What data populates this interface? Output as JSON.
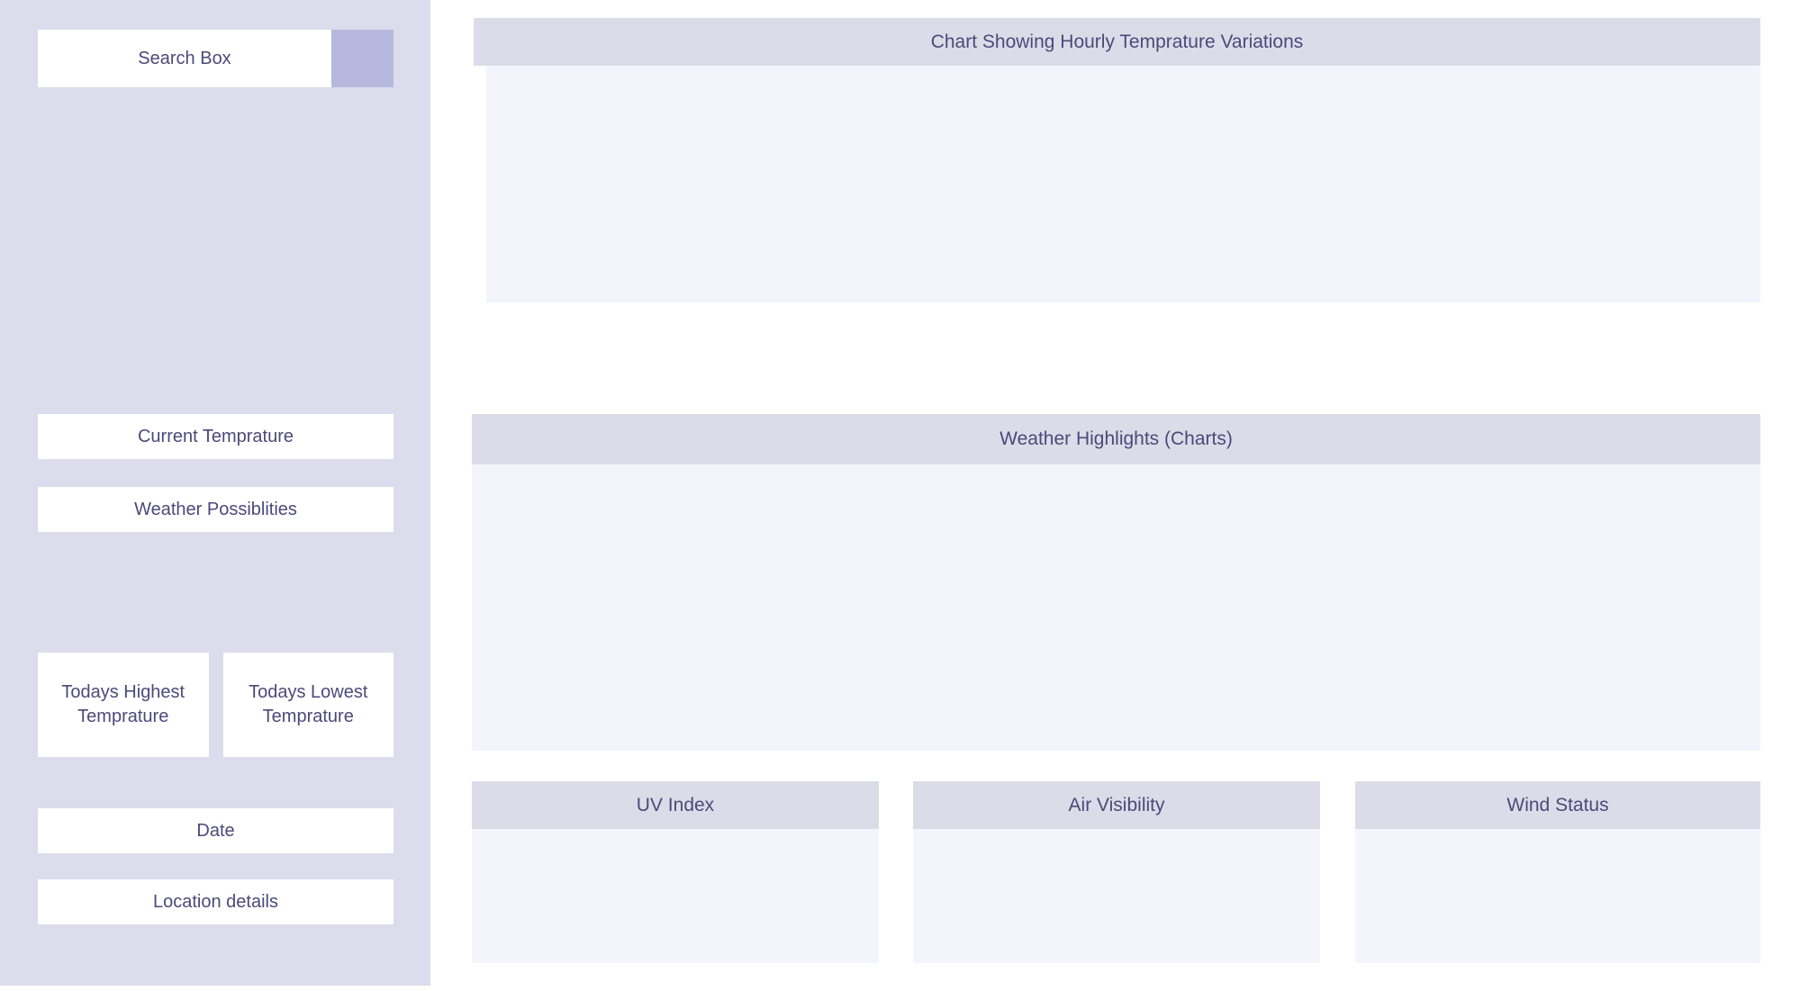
{
  "theme": {
    "sidebar_bg": "#dcdcec",
    "panel_header_bg": "#dcdce9",
    "panel_body_bg": "#f4f4fd",
    "accent": "#b6b8dd",
    "text": "#4a4a7a",
    "card_bg": "#ffffff"
  },
  "sidebar": {
    "search": {
      "placeholder": "Search Box",
      "value": "Search Box",
      "button_icon": "search-icon",
      "button_label": ""
    },
    "cards": {
      "current_temperature": "Current Temprature",
      "weather_possibilities": "Weather Possiblities",
      "todays_highest": "Todays Highest Temprature",
      "todays_lowest": "Todays Lowest Temprature",
      "date": "Date",
      "location": "Location details"
    }
  },
  "main": {
    "panels": {
      "hourly_chart": {
        "title": "Chart Showing Hourly Temprature Variations"
      },
      "highlights": {
        "title": "Weather Highlights (Charts)"
      },
      "uv_index": {
        "title": "UV Index"
      },
      "air_visibility": {
        "title": "Air Visibility"
      },
      "wind_status": {
        "title": "Wind Status"
      }
    }
  }
}
